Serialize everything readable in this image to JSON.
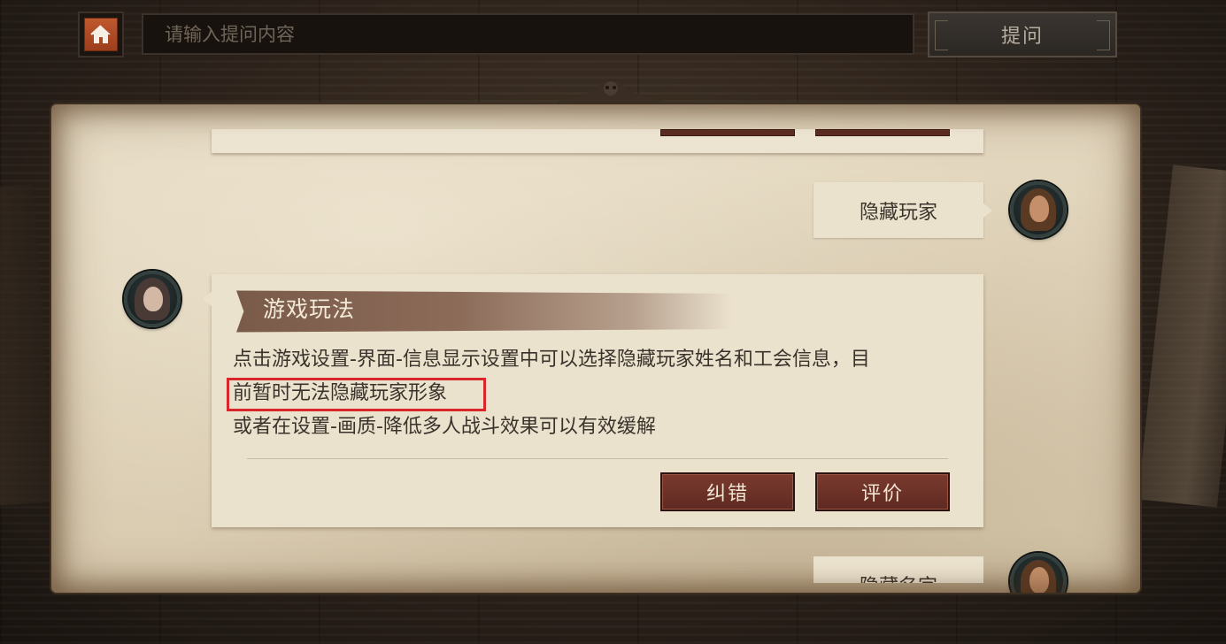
{
  "topbar": {
    "search_placeholder": "请输入提问内容",
    "ask_label": "提问"
  },
  "chat": {
    "user_message": "隐藏玩家",
    "next_user_message": "隐藏名字",
    "answer": {
      "category": "游戏玩法",
      "lines": [
        "点击游戏设置-界面-信息显示设置中可以选择隐藏玩家姓名和工会信息，目",
        "前暂时无法隐藏玩家形象",
        "或者在设置-画质-降低多人战斗效果可以有效缓解"
      ],
      "correct_label": "纠错",
      "rate_label": "评价"
    }
  },
  "colors": {
    "highlight": "#d9262b",
    "button": "#6b3126",
    "home": "#b24d25"
  },
  "icons": {
    "home": "home-icon"
  }
}
